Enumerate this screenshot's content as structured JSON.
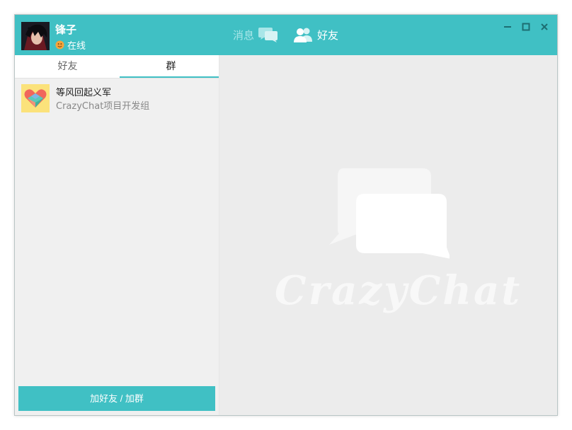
{
  "user": {
    "name": "锋子",
    "status": "在线"
  },
  "nav": {
    "messages_label": "消息",
    "friends_label": "好友"
  },
  "window_controls": {
    "minimize_icon": "minimize-icon",
    "maximize_icon": "maximize-icon",
    "close_icon": "close-icon"
  },
  "tabs": [
    {
      "label": "好友",
      "active": false
    },
    {
      "label": "群",
      "active": true
    }
  ],
  "groups": [
    {
      "name": "等风回起义军",
      "description": "CrazyChat项目开发组",
      "icon": "heart-group-icon"
    }
  ],
  "add_button_label": "加好友 / 加群",
  "watermark": {
    "text": "CrazyChat"
  },
  "colors": {
    "accent": "#40c0c4",
    "panel_bg": "#f0f0f0",
    "content_bg": "#ececec"
  }
}
